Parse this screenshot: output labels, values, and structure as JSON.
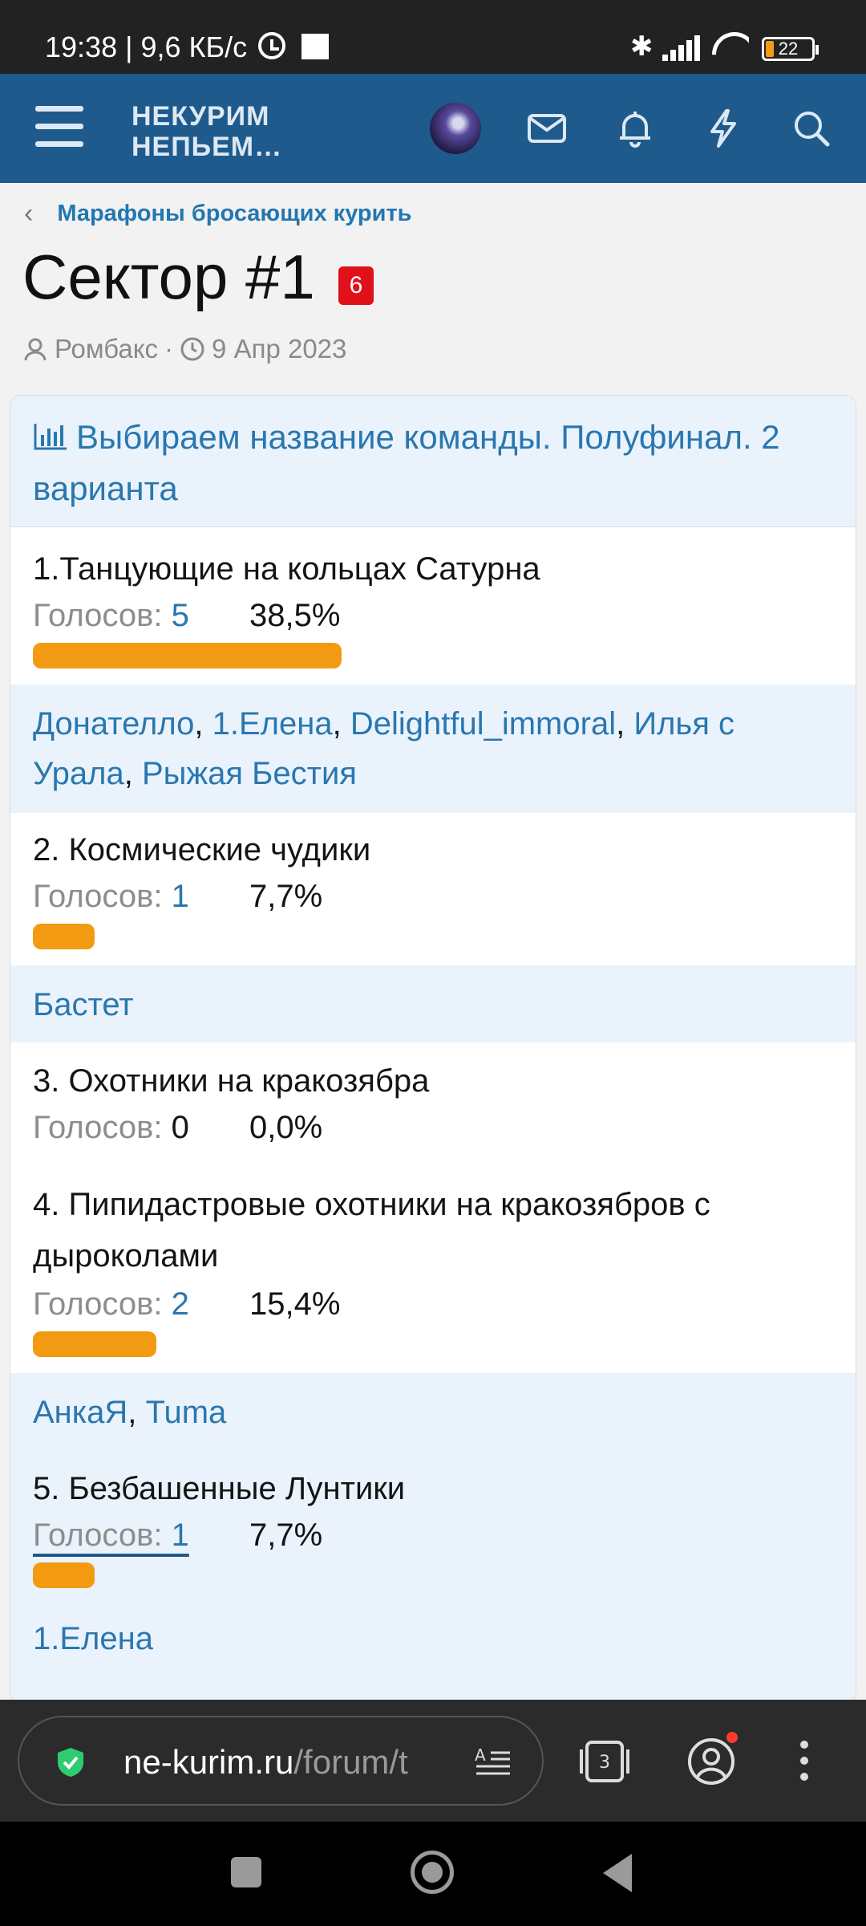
{
  "status_bar": {
    "time": "19:38 | 9,6 КБ/с",
    "battery": "22"
  },
  "header": {
    "logo_line1": "НЕКУРИМ",
    "logo_line2": "НЕПЬЕМ…"
  },
  "breadcrumb": {
    "label": "Марафоны бросающих курить"
  },
  "thread": {
    "title": "Сектор #1",
    "badge": "6",
    "author": "Ромбакс",
    "separator": "·",
    "date": "9 Апр 2023"
  },
  "poll": {
    "title": "Выбираем название команды. Полуфинал. 2 варианта",
    "votes_label": "Голосов:",
    "options": [
      {
        "label": "1.Танцующие на кольцах Сатурна",
        "votes": "5",
        "percent": "38,5%",
        "fraction": 0.385,
        "voters": [
          "Донателло",
          "1.Елена",
          "Delightful_immoral",
          "Илья с Урала",
          "Рыжая Бестия"
        ]
      },
      {
        "label": "2. Космические чудики",
        "votes": "1",
        "percent": "7,7%",
        "fraction": 0.077,
        "voters": [
          "Бастет"
        ]
      },
      {
        "label": "3. Охотники на кракозябра",
        "votes": "0",
        "percent": "0,0%",
        "fraction": 0.0,
        "voters": []
      },
      {
        "label": "4. Пипидастровые охотники на кракозябров с дыроколами",
        "votes": "2",
        "percent": "15,4%",
        "fraction": 0.154,
        "voters": [
          "АнкаЯ",
          "Tuma"
        ]
      },
      {
        "label": "5. Безбашенные Лунтики",
        "votes": "1",
        "percent": "7,7%",
        "fraction": 0.077,
        "voters": [
          "1.Елена"
        ]
      }
    ]
  },
  "browser": {
    "url_host": "ne-kurim.ru",
    "url_path": "/forum/t",
    "tab_count": "3"
  },
  "colors": {
    "header_bg": "#1f5a8c",
    "link": "#2a77b0",
    "bar": "#f29b12",
    "badge": "#e0111a"
  }
}
